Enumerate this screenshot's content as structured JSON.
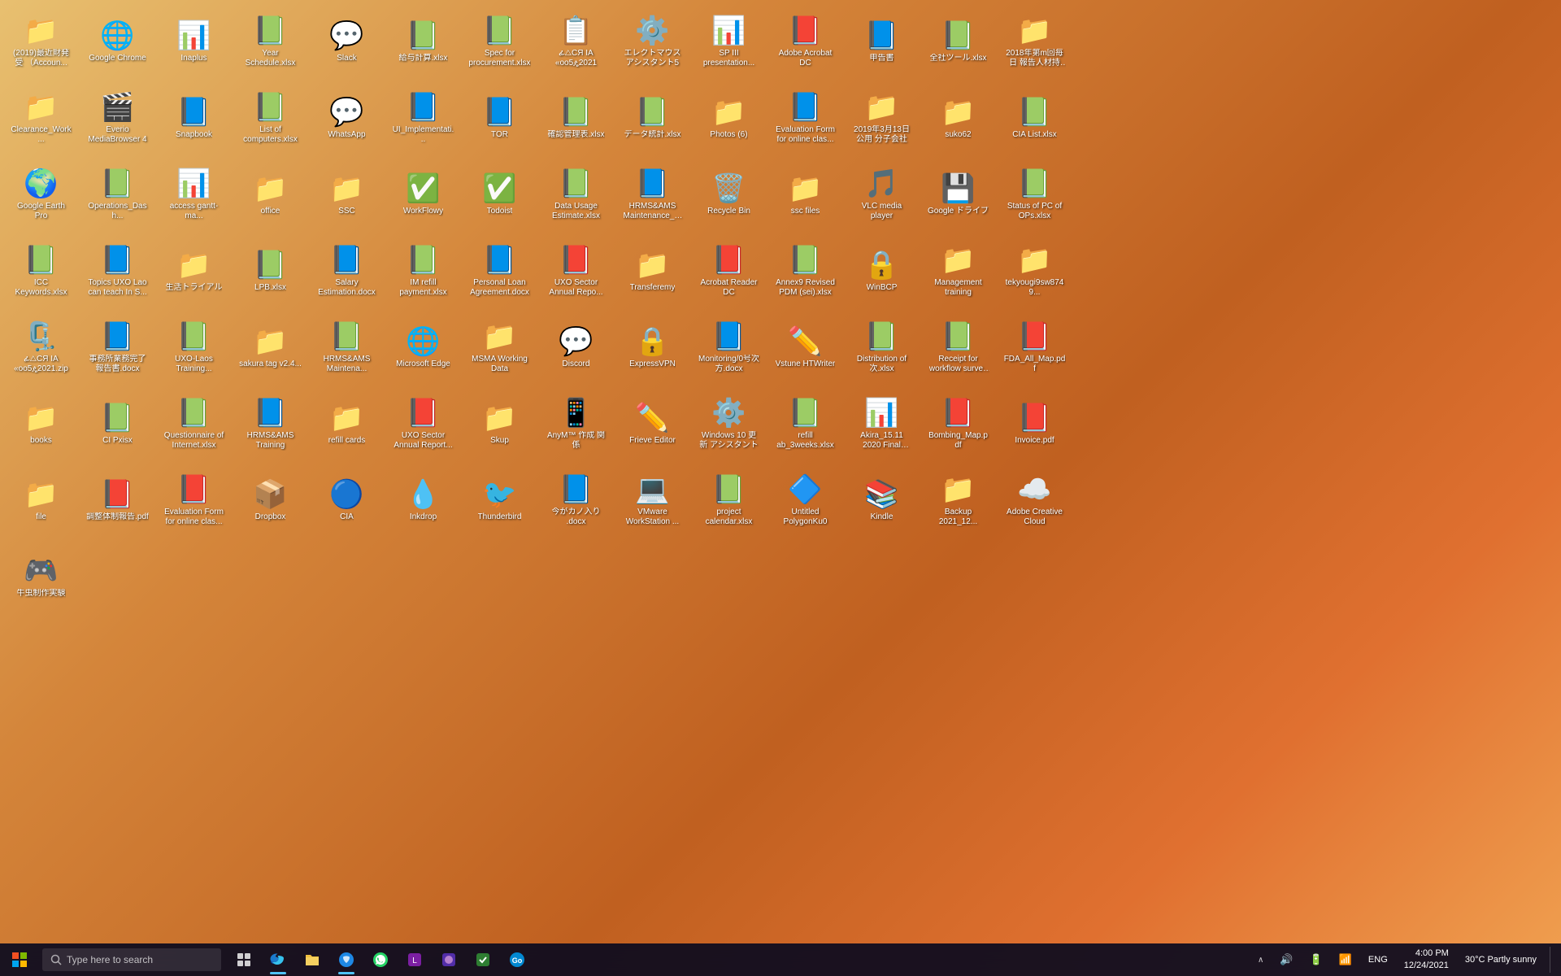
{
  "desktop": {
    "icons": [
      {
        "id": "win-acct",
        "label": "(2019)最近財発受\n（Accoun...",
        "type": "folder",
        "emoji": "📁"
      },
      {
        "id": "google-chrome",
        "label": "Google Chrome",
        "type": "app",
        "emoji": "🌐"
      },
      {
        "id": "inaplus",
        "label": "Inaplus",
        "type": "app",
        "emoji": "📊"
      },
      {
        "id": "year-schedule",
        "label": "Year Schedule.xlsx",
        "type": "excel",
        "emoji": "📗"
      },
      {
        "id": "slack",
        "label": "Slack",
        "type": "app",
        "emoji": "💬"
      },
      {
        "id": "kyuyo",
        "label": "給与計算.xlsx",
        "type": "excel",
        "emoji": "📗"
      },
      {
        "id": "spec-procurement",
        "label": "Spec for procurement.xlsx",
        "type": "excel",
        "emoji": "📗"
      },
      {
        "id": "qa-ia",
        "label": "ፊ△CЯ IA\n«oo5ዼ2021",
        "type": "app",
        "emoji": "📋"
      },
      {
        "id": "electron-mouse",
        "label": "エレクトマウスアシスタント5",
        "type": "app",
        "emoji": "⚙️"
      },
      {
        "id": "sp3-presentation",
        "label": "SP III presentation...",
        "type": "ppt",
        "emoji": "📊"
      },
      {
        "id": "adobe-acrobat-dc",
        "label": "Adobe Acrobat DC",
        "type": "pdf",
        "emoji": "📕"
      },
      {
        "id": "moushisho",
        "label": "申告書",
        "type": "word",
        "emoji": "📘"
      },
      {
        "id": "zenkoku-xlsx",
        "label": "全社ツール.xlsx",
        "type": "excel",
        "emoji": "📗"
      },
      {
        "id": "folder-2018",
        "label": "2018年第m回毎日\n報告人材持ち...",
        "type": "folder",
        "emoji": "📁"
      },
      {
        "id": "clearance-work",
        "label": "Clearance_Work...",
        "type": "folder",
        "emoji": "📁"
      },
      {
        "id": "everio",
        "label": "Everio MediaBrowser 4",
        "type": "app",
        "emoji": "🎬"
      },
      {
        "id": "snapbook",
        "label": "Snapbook",
        "type": "app",
        "emoji": "📘"
      },
      {
        "id": "list-computers",
        "label": "List of computers.xlsx",
        "type": "excel",
        "emoji": "📗"
      },
      {
        "id": "whatsapp",
        "label": "WhatsApp",
        "type": "app",
        "emoji": "💬"
      },
      {
        "id": "ui-implementation",
        "label": "UI_Implementati...",
        "type": "word",
        "emoji": "📘"
      },
      {
        "id": "tor",
        "label": "TOR",
        "type": "word",
        "emoji": "📘"
      },
      {
        "id": "kansai-xlsx",
        "label": "確認管理表.xlsx",
        "type": "excel",
        "emoji": "📗"
      },
      {
        "id": "data-toukei",
        "label": "データ統計.xlsx",
        "type": "excel",
        "emoji": "📗"
      },
      {
        "id": "photos6",
        "label": "Photos (6)",
        "type": "folder",
        "emoji": "📁"
      },
      {
        "id": "eval-form-online",
        "label": "Evaluation Form for online clas...",
        "type": "word",
        "emoji": "📘"
      },
      {
        "id": "folder-2019",
        "label": "2019年3月13日公用\n分子会社",
        "type": "folder",
        "emoji": "📁"
      },
      {
        "id": "suko62",
        "label": "suko62",
        "type": "folder",
        "emoji": "📁"
      },
      {
        "id": "cia-list",
        "label": "CIA List.xlsx",
        "type": "excel",
        "emoji": "📗"
      },
      {
        "id": "google-earth-pro",
        "label": "Google Earth Pro",
        "type": "app",
        "emoji": "🌍"
      },
      {
        "id": "operations-dash",
        "label": "Operations_Dash...",
        "type": "excel",
        "emoji": "📗"
      },
      {
        "id": "access-gantt",
        "label": "access gantt-ma...",
        "type": "app",
        "emoji": "📊"
      },
      {
        "id": "office",
        "label": "office",
        "type": "folder",
        "emoji": "📁"
      },
      {
        "id": "ssc",
        "label": "SSC",
        "type": "folder",
        "emoji": "📁"
      },
      {
        "id": "workflowy",
        "label": "WorkFlowy",
        "type": "app",
        "emoji": "✅"
      },
      {
        "id": "todoist",
        "label": "Todoist",
        "type": "app",
        "emoji": "✅"
      },
      {
        "id": "data-usage-estimate",
        "label": "Data Usage Estimate.xlsx",
        "type": "excel",
        "emoji": "📗"
      },
      {
        "id": "hrms-maintenance-tai",
        "label": "HRMS&AMS Maintenance_Trai...",
        "type": "word",
        "emoji": "📘"
      },
      {
        "id": "recycle-bin",
        "label": "Recycle Bin",
        "type": "special",
        "emoji": "🗑️"
      },
      {
        "id": "ssc-files",
        "label": "ssc files",
        "type": "folder",
        "emoji": "📁"
      },
      {
        "id": "vlc",
        "label": "VLC media player",
        "type": "app",
        "emoji": "🎵"
      },
      {
        "id": "google-drive",
        "label": "Google ドライブ",
        "type": "app",
        "emoji": "💾"
      },
      {
        "id": "status-pc-xlsx",
        "label": "Status of PC of OPs.xlsx",
        "type": "excel",
        "emoji": "📗"
      },
      {
        "id": "icc-keywords",
        "label": "ICC Keywords.xlsx",
        "type": "excel",
        "emoji": "📗"
      },
      {
        "id": "topics-uxo-lao",
        "label": "Topics UXO Lao can teach In S...",
        "type": "word",
        "emoji": "📘"
      },
      {
        "id": "seikatsu-trial",
        "label": "生活トライアル",
        "type": "folder",
        "emoji": "📁"
      },
      {
        "id": "lpb-xlsx",
        "label": "LPB.xlsx",
        "type": "excel",
        "emoji": "📗"
      },
      {
        "id": "salary-estimation",
        "label": "Salary Estimation.docx",
        "type": "word",
        "emoji": "📘"
      },
      {
        "id": "im-refill-payment",
        "label": "IM refill payment.xlsx",
        "type": "excel",
        "emoji": "📗"
      },
      {
        "id": "personal-loan",
        "label": "Personal Loan Agreement.docx",
        "type": "word",
        "emoji": "📘"
      },
      {
        "id": "uxo-sector-annual1",
        "label": "UXO Sector Annual Repo...",
        "type": "pdf",
        "emoji": "📕"
      },
      {
        "id": "transferemy",
        "label": "Transferemy",
        "type": "folder",
        "emoji": "📁"
      },
      {
        "id": "acrobat-reader-dc",
        "label": "Acrobat Reader DC",
        "type": "pdf",
        "emoji": "📕"
      },
      {
        "id": "annex9-revised-pdm",
        "label": "Annex9 Revised PDM (sei).xlsx",
        "type": "excel",
        "emoji": "📗"
      },
      {
        "id": "winbmp",
        "label": "WinBCP",
        "type": "app",
        "emoji": "🔒"
      },
      {
        "id": "management-training",
        "label": "Management training",
        "type": "folder",
        "emoji": "📁"
      },
      {
        "id": "tekyougi9sw8749",
        "label": "tekyougi9sw8749...",
        "type": "folder",
        "emoji": "📁"
      },
      {
        "id": "qa-ia2",
        "label": "ፊ△CЯ IA «oo5ዼ2021.zip",
        "type": "zip",
        "emoji": "🗜️"
      },
      {
        "id": "jmusho-kanryo",
        "label": "事務所業務完了\n報告書.docx",
        "type": "word",
        "emoji": "📘"
      },
      {
        "id": "uxo-laos-training",
        "label": "UXO-Laos Training...",
        "type": "excel",
        "emoji": "📗"
      },
      {
        "id": "sakura-tag",
        "label": "sakura tag v2.4...",
        "type": "folder",
        "emoji": "📁"
      },
      {
        "id": "hrms-maintenance2",
        "label": "HRMS&AMS Maintena...",
        "type": "excel",
        "emoji": "📗"
      },
      {
        "id": "microsoft-edge",
        "label": "Microsoft Edge",
        "type": "app",
        "emoji": "🌐"
      },
      {
        "id": "msma-working-data",
        "label": "MSMA Working Data",
        "type": "folder",
        "emoji": "📁"
      },
      {
        "id": "discord",
        "label": "Discord",
        "type": "app",
        "emoji": "💬"
      },
      {
        "id": "expressvpn",
        "label": "ExpressVPN",
        "type": "app",
        "emoji": "🔒"
      },
      {
        "id": "monitoring-xlsx",
        "label": "Monitoring/0号次\n方.docx",
        "type": "word",
        "emoji": "📘"
      },
      {
        "id": "vstune-htwriter",
        "label": "Vstune HTWriter",
        "type": "app",
        "emoji": "✏️"
      },
      {
        "id": "distribution-xlsx",
        "label": "Distribution of次.xlsx",
        "type": "excel",
        "emoji": "📗"
      },
      {
        "id": "receipt-workflow",
        "label": "Receipt for workflow survey ...",
        "type": "excel",
        "emoji": "📗"
      },
      {
        "id": "fda-all-map",
        "label": "FDA_All_Map.pdf",
        "type": "pdf",
        "emoji": "📕"
      },
      {
        "id": "books",
        "label": "books",
        "type": "folder",
        "emoji": "📁"
      },
      {
        "id": "ci-pxisx",
        "label": "CI Pxisx",
        "type": "excel",
        "emoji": "📗"
      },
      {
        "id": "questionnaire-internet",
        "label": "Questionnaire of Internet.xlsx",
        "type": "excel",
        "emoji": "📗"
      },
      {
        "id": "hrms-training",
        "label": "HRMS&AMS Training",
        "type": "word",
        "emoji": "📘"
      },
      {
        "id": "refill-cards",
        "label": "refill cards",
        "type": "folder",
        "emoji": "📁"
      },
      {
        "id": "uxo-sector-annual2",
        "label": "UXO Sector Annual Report...",
        "type": "pdf",
        "emoji": "📕"
      },
      {
        "id": "skup",
        "label": "Skup",
        "type": "folder",
        "emoji": "📁"
      },
      {
        "id": "anymп-fuzu",
        "label": "AnyM™ 作成\n関係",
        "type": "app",
        "emoji": "📱"
      },
      {
        "id": "frieve-editor",
        "label": "Frieve Editor",
        "type": "app",
        "emoji": "✏️"
      },
      {
        "id": "windows10-koshin",
        "label": "Windows 10 更新\nアシスタント",
        "type": "app",
        "emoji": "⚙️"
      },
      {
        "id": "refill-ab-3weeks",
        "label": "refill ab_3weeks.xlsx",
        "type": "excel",
        "emoji": "📗"
      },
      {
        "id": "akira-final",
        "label": "Akira_15.11 2020 Final Presentati...",
        "type": "ppt",
        "emoji": "📊"
      },
      {
        "id": "bombing-map",
        "label": "Bombing_Map.pdf",
        "type": "pdf",
        "emoji": "📕"
      },
      {
        "id": "invoice-pdf",
        "label": "Invoice.pdf",
        "type": "pdf",
        "emoji": "📕"
      },
      {
        "id": "file",
        "label": "file",
        "type": "folder",
        "emoji": "📁"
      },
      {
        "id": "choshu-pdf",
        "label": "調整体制報告.pdf",
        "type": "pdf",
        "emoji": "📕"
      },
      {
        "id": "eval-form-online2",
        "label": "Evaluation Form for online clas...",
        "type": "pdf",
        "emoji": "📕"
      },
      {
        "id": "dropbox",
        "label": "Dropbox",
        "type": "app",
        "emoji": "📦"
      },
      {
        "id": "cia-app",
        "label": "CIA",
        "type": "app",
        "emoji": "🔵"
      },
      {
        "id": "inkdrop",
        "label": "Inkdrop",
        "type": "app",
        "emoji": "💧"
      },
      {
        "id": "thunderbird",
        "label": "Thunderbird",
        "type": "app",
        "emoji": "🐦"
      },
      {
        "id": "ima-kanryu",
        "label": "今がカノ入り\n.docx",
        "type": "word",
        "emoji": "📘"
      },
      {
        "id": "vmware",
        "label": "VMware WorkStation ...",
        "type": "app",
        "emoji": "💻"
      },
      {
        "id": "project-calendar",
        "label": "project calendar.xlsx",
        "type": "excel",
        "emoji": "📗"
      },
      {
        "id": "untitled-polygon",
        "label": "Untitled PolygonKu0",
        "type": "app",
        "emoji": "🔷"
      },
      {
        "id": "kindle",
        "label": "Kindle",
        "type": "app",
        "emoji": "📚"
      },
      {
        "id": "backup-2021",
        "label": "Backup 2021_12...",
        "type": "folder",
        "emoji": "📁"
      },
      {
        "id": "adobe-creative-cloud",
        "label": "Adobe Creative Cloud",
        "type": "app",
        "emoji": "☁️"
      },
      {
        "id": "gyumushi",
        "label": "牛虫制作実験",
        "type": "app",
        "emoji": "🎮"
      }
    ]
  },
  "taskbar": {
    "search_placeholder": "Type here to search",
    "time": "4:00 PM",
    "date": "12/24/2021",
    "temperature": "30°C  Partly sunny",
    "language": "ENG",
    "battery": "100%"
  }
}
